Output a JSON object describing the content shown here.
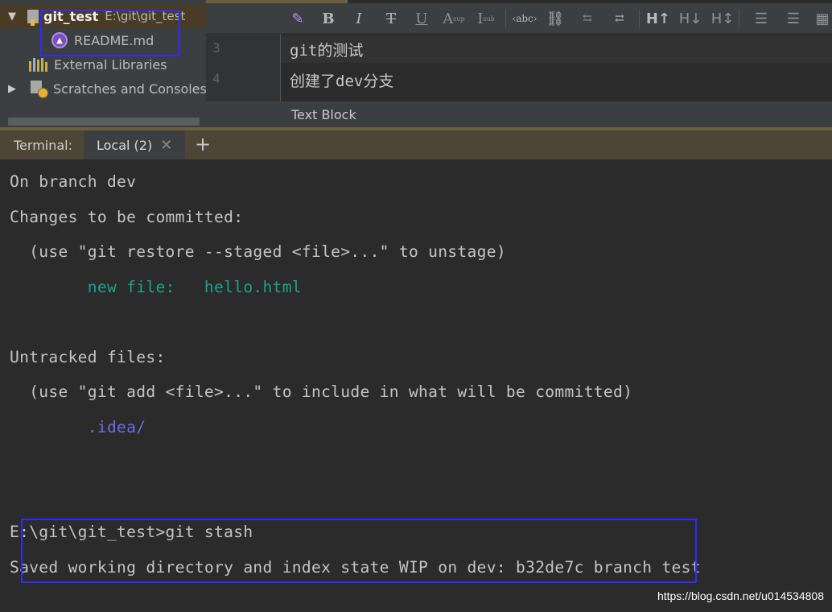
{
  "project_tree": {
    "project_name": "git_test",
    "project_path": "E:\\git\\git_test",
    "readme": "README.md",
    "external_libraries": "External Libraries",
    "scratches": "Scratches and Consoles"
  },
  "editor": {
    "toolbar_icons": [
      "edit-pencil-icon",
      "bold-icon",
      "italic-icon",
      "strikethrough-icon",
      "underline-icon",
      "superscript-icon",
      "subscript-icon",
      "code-icon",
      "link-icon",
      "unlink-icon",
      "auto-link-icon",
      "header-up-icon",
      "header-down-icon",
      "header-toggle-icon",
      "list-indent-icon",
      "list-outdent-icon",
      "table-icon"
    ],
    "lines": [
      {
        "number": "3",
        "text": "git的测试"
      },
      {
        "number": "4",
        "text": "创建了dev分支"
      }
    ],
    "status_label": "Text Block"
  },
  "terminal": {
    "label": "Terminal:",
    "tab_label": "Local (2)",
    "lines": [
      "On branch dev",
      "Changes to be committed:",
      "  (use \"git restore --staged <file>...\" to unstage)",
      "        new file:   hello.html",
      "",
      "Untracked files:",
      "  (use \"git add <file>...\" to include in what will be committed)",
      "        .idea/",
      "",
      "",
      "E:\\git\\git_test>git stash",
      "Saved working directory and index state WIP on dev: b32de7c branch test"
    ]
  },
  "watermark": "https://blog.csdn.net/u014534808",
  "colors": {
    "background": "#2b2b2b",
    "panel": "#3c3f41",
    "green": "#19a48a",
    "purple": "#6f6ae8",
    "highlight_box": "#2d2bff"
  }
}
